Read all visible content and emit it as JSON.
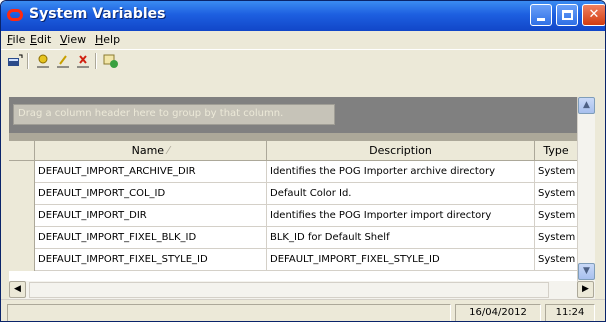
{
  "window": {
    "title": "System Variables"
  },
  "menu": {
    "items": [
      {
        "label": "File",
        "accel": "F",
        "rest": "ile"
      },
      {
        "label": "Edit",
        "accel": "E",
        "rest": "dit"
      },
      {
        "label": "View",
        "accel": "V",
        "rest": "iew"
      },
      {
        "label": "Help",
        "accel": "H",
        "rest": "elp"
      }
    ]
  },
  "toolbar": {
    "icons": [
      "table-icon",
      "new-item-icon",
      "edit-icon",
      "delete-icon",
      "refresh-icon"
    ]
  },
  "grid": {
    "group_hint": "Drag a column header here to group by that column.",
    "columns": [
      {
        "label": "Name",
        "sort": "ascending"
      },
      {
        "label": "Description"
      },
      {
        "label": "Type"
      }
    ],
    "rows": [
      {
        "name": "DEFAULT_IMPORT_ARCHIVE_DIR",
        "description": "Identifies the POG Importer archive directory",
        "type": "System"
      },
      {
        "name": "DEFAULT_IMPORT_COL_ID",
        "description": "Default Color Id.",
        "type": "System"
      },
      {
        "name": "DEFAULT_IMPORT_DIR",
        "description": "Identifies the POG Importer import directory",
        "type": "System"
      },
      {
        "name": "DEFAULT_IMPORT_FIXEL_BLK_ID",
        "description": "BLK_ID for Default Shelf",
        "type": "System"
      },
      {
        "name": "DEFAULT_IMPORT_FIXEL_STYLE_ID",
        "description": "DEFAULT_IMPORT_FIXEL_STYLE_ID",
        "type": "System"
      }
    ]
  },
  "status": {
    "date": "16/04/2012",
    "time": "11:24"
  },
  "colors": {
    "title_bar": "#1d5fe0",
    "close_button": "#d23c10",
    "app_icon": "#ff2a10"
  }
}
